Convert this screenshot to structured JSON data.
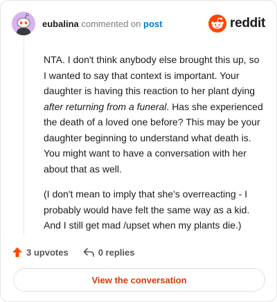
{
  "comment": {
    "username": "eubalina",
    "action_text": "commented on",
    "target_link": "post",
    "paragraph_1_pre": "NTA. I don't think anybody else brought this up, so I wanted to say that context is important. Your daughter is having this reaction to her plant dying ",
    "paragraph_1_em": "after returning from a funeral",
    "paragraph_1_post": ". Has she experienced the death of a loved one before? This may be your daughter beginning to understand what death is. You might want to have a conversation with her about that as well.",
    "paragraph_2": "(I don't mean to imply that she's overreacting - I probably would have felt the same way as a kid. And I still get mad /upset when my plants die.)"
  },
  "brand": {
    "wordmark": "reddit",
    "icon": "reddit-snoo-icon",
    "color": "#ff4500"
  },
  "actions": {
    "upvotes_label": "3 upvotes",
    "replies_label": "0 replies",
    "upvote_icon": "upvote-arrow-icon",
    "reply_icon": "reply-arrow-icon"
  },
  "footer": {
    "view_button_label": "View the conversation"
  },
  "colors": {
    "accent": "#d93a00",
    "link": "#0079d3",
    "avatar_bg": "#d9b3ef"
  }
}
